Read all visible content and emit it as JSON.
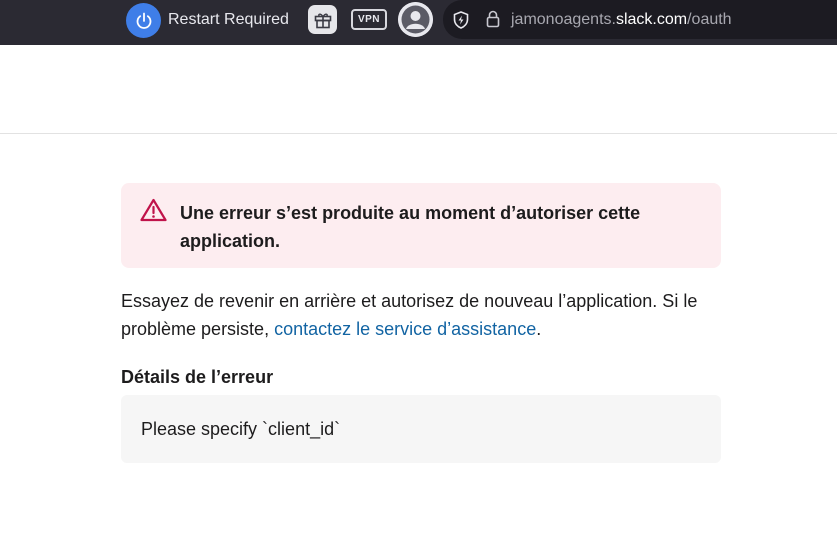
{
  "browser": {
    "restart_label": "Restart Required",
    "vpn_label": "VPN",
    "url_prefix": "jamonoagents.",
    "url_domain": "slack.com",
    "url_path": "/oauth"
  },
  "error": {
    "title": "Une erreur s’est produite au moment d’autoriser cette application.",
    "accent_color": "#c0134a",
    "background_color": "#fdedf0"
  },
  "help": {
    "text": "Essayez de revenir en arrière et autorisez de nouveau l’application. Si le problème persiste, ",
    "link_text": "contactez le service d’assistance",
    "suffix": "."
  },
  "details": {
    "title": "Détails de l’erreur",
    "message": "Please specify `client_id`"
  }
}
